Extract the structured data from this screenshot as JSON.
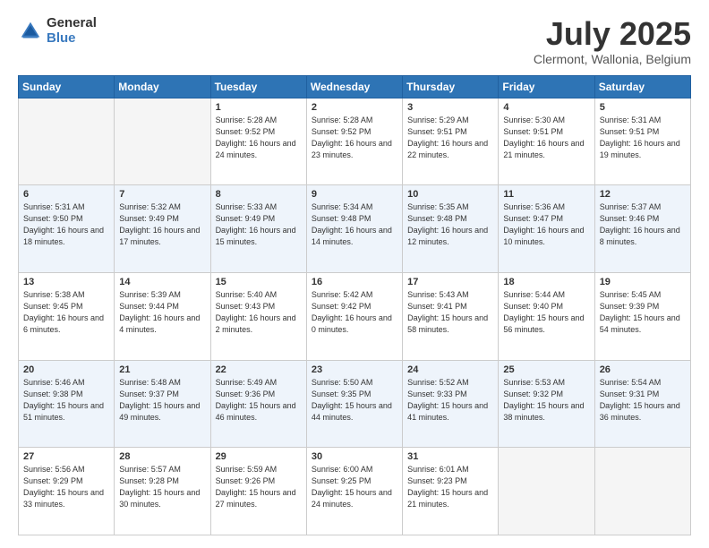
{
  "header": {
    "logo_general": "General",
    "logo_blue": "Blue",
    "month_title": "July 2025",
    "location": "Clermont, Wallonia, Belgium"
  },
  "days_of_week": [
    "Sunday",
    "Monday",
    "Tuesday",
    "Wednesday",
    "Thursday",
    "Friday",
    "Saturday"
  ],
  "weeks": [
    [
      {
        "day": "",
        "info": ""
      },
      {
        "day": "",
        "info": ""
      },
      {
        "day": "1",
        "info": "Sunrise: 5:28 AM\nSunset: 9:52 PM\nDaylight: 16 hours\nand 24 minutes."
      },
      {
        "day": "2",
        "info": "Sunrise: 5:28 AM\nSunset: 9:52 PM\nDaylight: 16 hours\nand 23 minutes."
      },
      {
        "day": "3",
        "info": "Sunrise: 5:29 AM\nSunset: 9:51 PM\nDaylight: 16 hours\nand 22 minutes."
      },
      {
        "day": "4",
        "info": "Sunrise: 5:30 AM\nSunset: 9:51 PM\nDaylight: 16 hours\nand 21 minutes."
      },
      {
        "day": "5",
        "info": "Sunrise: 5:31 AM\nSunset: 9:51 PM\nDaylight: 16 hours\nand 19 minutes."
      }
    ],
    [
      {
        "day": "6",
        "info": "Sunrise: 5:31 AM\nSunset: 9:50 PM\nDaylight: 16 hours\nand 18 minutes."
      },
      {
        "day": "7",
        "info": "Sunrise: 5:32 AM\nSunset: 9:49 PM\nDaylight: 16 hours\nand 17 minutes."
      },
      {
        "day": "8",
        "info": "Sunrise: 5:33 AM\nSunset: 9:49 PM\nDaylight: 16 hours\nand 15 minutes."
      },
      {
        "day": "9",
        "info": "Sunrise: 5:34 AM\nSunset: 9:48 PM\nDaylight: 16 hours\nand 14 minutes."
      },
      {
        "day": "10",
        "info": "Sunrise: 5:35 AM\nSunset: 9:48 PM\nDaylight: 16 hours\nand 12 minutes."
      },
      {
        "day": "11",
        "info": "Sunrise: 5:36 AM\nSunset: 9:47 PM\nDaylight: 16 hours\nand 10 minutes."
      },
      {
        "day": "12",
        "info": "Sunrise: 5:37 AM\nSunset: 9:46 PM\nDaylight: 16 hours\nand 8 minutes."
      }
    ],
    [
      {
        "day": "13",
        "info": "Sunrise: 5:38 AM\nSunset: 9:45 PM\nDaylight: 16 hours\nand 6 minutes."
      },
      {
        "day": "14",
        "info": "Sunrise: 5:39 AM\nSunset: 9:44 PM\nDaylight: 16 hours\nand 4 minutes."
      },
      {
        "day": "15",
        "info": "Sunrise: 5:40 AM\nSunset: 9:43 PM\nDaylight: 16 hours\nand 2 minutes."
      },
      {
        "day": "16",
        "info": "Sunrise: 5:42 AM\nSunset: 9:42 PM\nDaylight: 16 hours\nand 0 minutes."
      },
      {
        "day": "17",
        "info": "Sunrise: 5:43 AM\nSunset: 9:41 PM\nDaylight: 15 hours\nand 58 minutes."
      },
      {
        "day": "18",
        "info": "Sunrise: 5:44 AM\nSunset: 9:40 PM\nDaylight: 15 hours\nand 56 minutes."
      },
      {
        "day": "19",
        "info": "Sunrise: 5:45 AM\nSunset: 9:39 PM\nDaylight: 15 hours\nand 54 minutes."
      }
    ],
    [
      {
        "day": "20",
        "info": "Sunrise: 5:46 AM\nSunset: 9:38 PM\nDaylight: 15 hours\nand 51 minutes."
      },
      {
        "day": "21",
        "info": "Sunrise: 5:48 AM\nSunset: 9:37 PM\nDaylight: 15 hours\nand 49 minutes."
      },
      {
        "day": "22",
        "info": "Sunrise: 5:49 AM\nSunset: 9:36 PM\nDaylight: 15 hours\nand 46 minutes."
      },
      {
        "day": "23",
        "info": "Sunrise: 5:50 AM\nSunset: 9:35 PM\nDaylight: 15 hours\nand 44 minutes."
      },
      {
        "day": "24",
        "info": "Sunrise: 5:52 AM\nSunset: 9:33 PM\nDaylight: 15 hours\nand 41 minutes."
      },
      {
        "day": "25",
        "info": "Sunrise: 5:53 AM\nSunset: 9:32 PM\nDaylight: 15 hours\nand 38 minutes."
      },
      {
        "day": "26",
        "info": "Sunrise: 5:54 AM\nSunset: 9:31 PM\nDaylight: 15 hours\nand 36 minutes."
      }
    ],
    [
      {
        "day": "27",
        "info": "Sunrise: 5:56 AM\nSunset: 9:29 PM\nDaylight: 15 hours\nand 33 minutes."
      },
      {
        "day": "28",
        "info": "Sunrise: 5:57 AM\nSunset: 9:28 PM\nDaylight: 15 hours\nand 30 minutes."
      },
      {
        "day": "29",
        "info": "Sunrise: 5:59 AM\nSunset: 9:26 PM\nDaylight: 15 hours\nand 27 minutes."
      },
      {
        "day": "30",
        "info": "Sunrise: 6:00 AM\nSunset: 9:25 PM\nDaylight: 15 hours\nand 24 minutes."
      },
      {
        "day": "31",
        "info": "Sunrise: 6:01 AM\nSunset: 9:23 PM\nDaylight: 15 hours\nand 21 minutes."
      },
      {
        "day": "",
        "info": ""
      },
      {
        "day": "",
        "info": ""
      }
    ]
  ]
}
